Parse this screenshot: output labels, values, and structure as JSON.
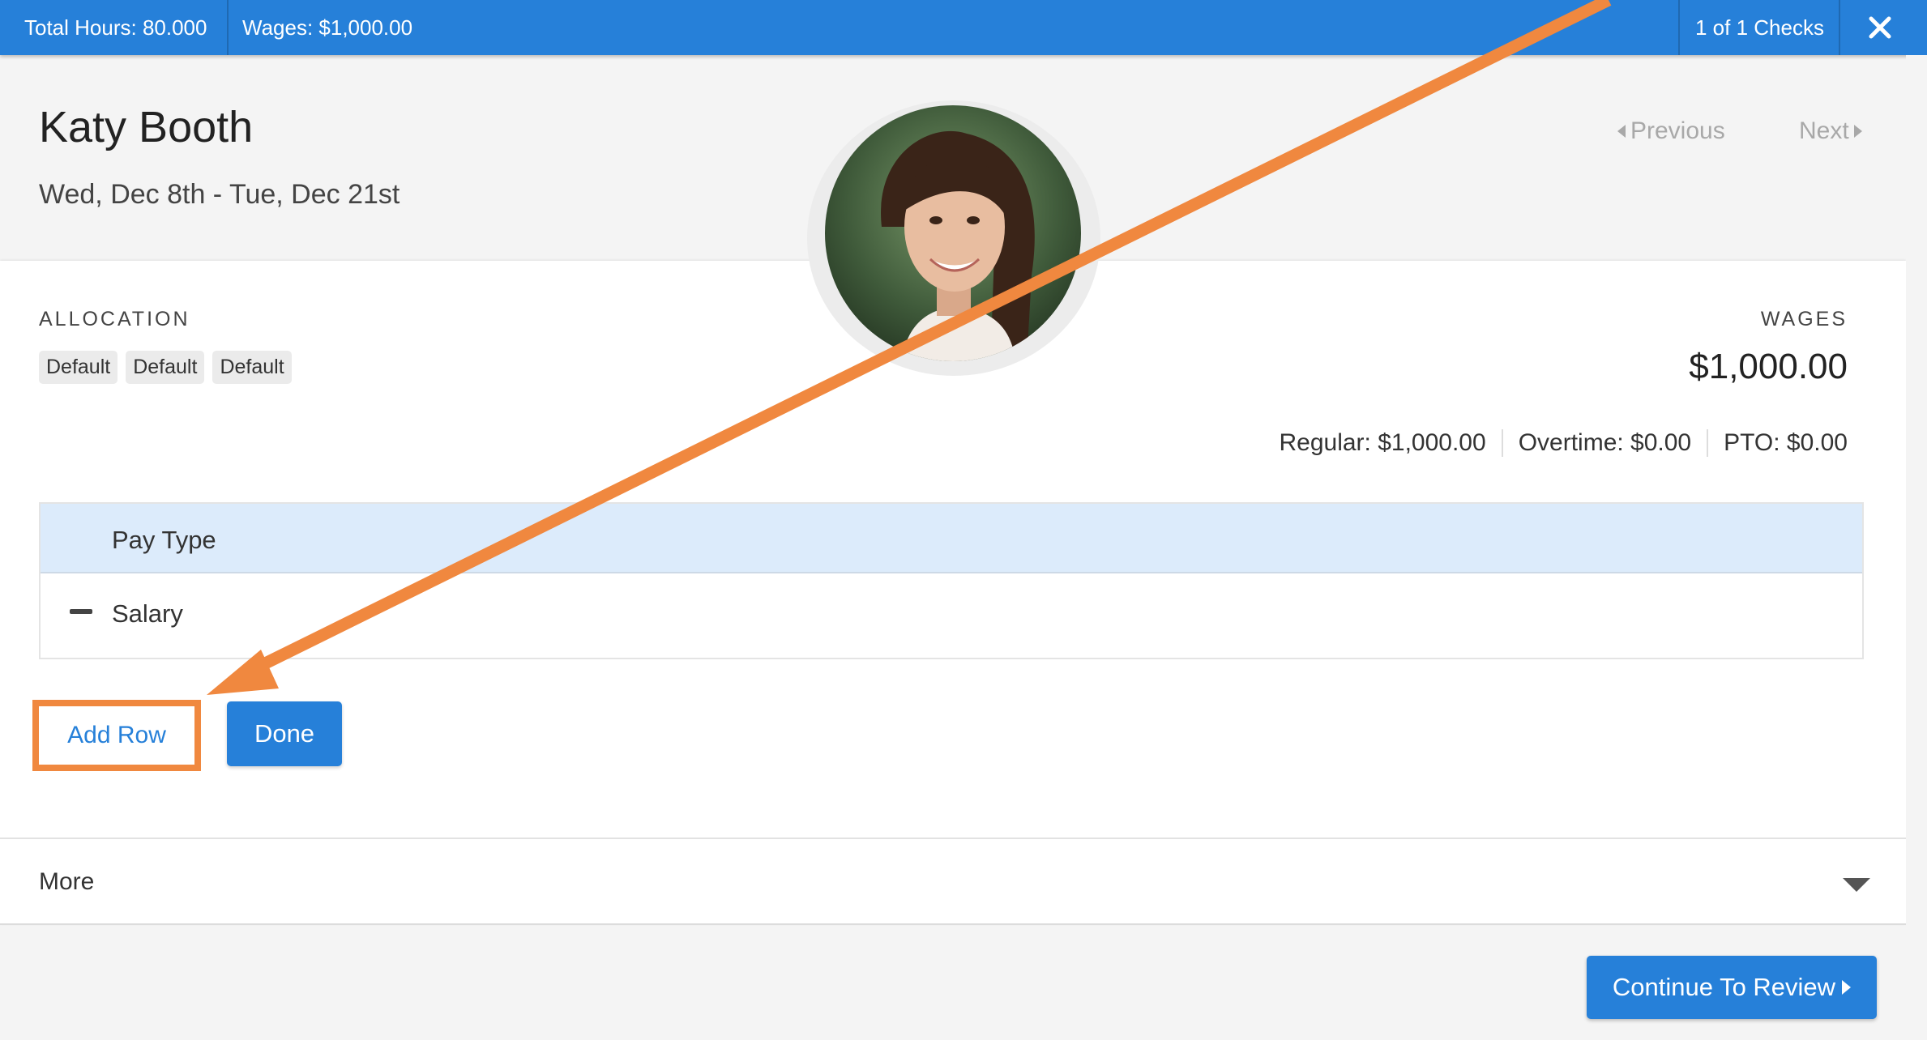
{
  "topbar": {
    "total_hours": "Total Hours: 80.000",
    "wages": "Wages: $1,000.00",
    "checks": "1 of 1 Checks",
    "close_icon": "close-icon"
  },
  "header": {
    "name": "Katy Booth",
    "date_range": "Wed, Dec 8th - Tue, Dec 21st",
    "previous_label": "Previous",
    "next_label": "Next"
  },
  "allocation": {
    "label": "ALLOCATION",
    "tags": [
      "Default",
      "Default",
      "Default"
    ]
  },
  "wages": {
    "label": "WAGES",
    "amount": "$1,000.00",
    "breakdown": {
      "regular": "Regular: $1,000.00",
      "overtime": "Overtime: $0.00",
      "pto": "PTO: $0.00"
    }
  },
  "table": {
    "header": "Pay Type",
    "rows": [
      {
        "pay_type": "Salary",
        "icon": "minus-icon"
      }
    ]
  },
  "buttons": {
    "add_row": "Add Row",
    "done": "Done",
    "continue": "Continue To Review"
  },
  "more": {
    "label": "More",
    "icon": "caret-down-icon"
  },
  "colors": {
    "primary": "#2680d9",
    "annotation": "#f0883f",
    "table_header": "#dcebfb"
  }
}
